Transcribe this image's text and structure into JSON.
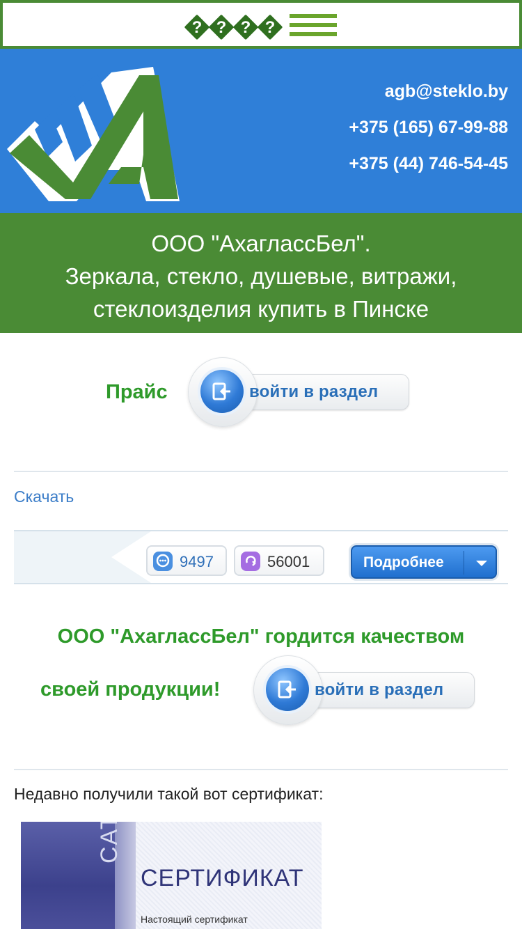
{
  "topbar": {
    "glyphs": [
      "?",
      "?",
      "?",
      "?"
    ],
    "menu_icon": "hamburger-icon"
  },
  "header": {
    "email": "agb@steklo.by",
    "phone1": "+375 (165) 67-99-88",
    "phone2": "+375 (44) 746-54-45",
    "colors": {
      "blue": "#2f7fd8",
      "green": "#4a8b35"
    }
  },
  "title": {
    "line1": "ООО \"АхагласcБел\".",
    "line2": "Зеркала, стекло, душевые, витражи,",
    "line3": "стеклоизделия купить в Пинске"
  },
  "price": {
    "label": "Прайс",
    "button": "войти в раздел"
  },
  "download": {
    "link": "Скачать"
  },
  "share": {
    "comments_count": "9497",
    "reposts_count": "56001",
    "details_button": "Подробнее"
  },
  "proud": {
    "line1": "ООО \"АхагласcБел\" гордится качеством",
    "line2": "своей продукции!",
    "button": "войти в раздел"
  },
  "certificate": {
    "intro": "Недавно получили такой вот сертификат:",
    "side_text": "CATE",
    "title": "СЕРТИФИКАТ",
    "subtitle": "Настоящий сертификат"
  }
}
